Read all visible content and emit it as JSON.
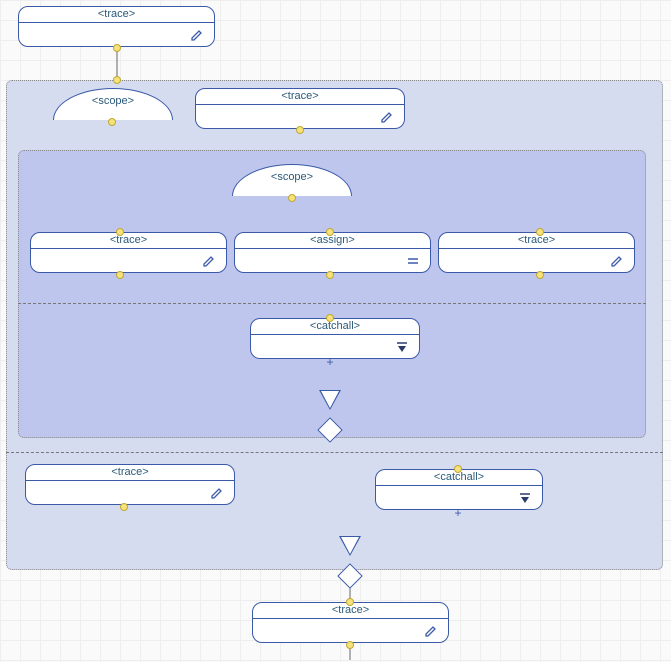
{
  "nodes": {
    "topTrace": {
      "label": "<trace>"
    },
    "outerScope": {
      "label": "<scope>"
    },
    "outerScopeTrace": {
      "label": "<trace>"
    },
    "innerScope": {
      "label": "<scope>"
    },
    "innerTraceL": {
      "label": "<trace>"
    },
    "assign": {
      "label": "<assign>"
    },
    "innerTraceR": {
      "label": "<trace>"
    },
    "lowerCatchall": {
      "label": "<catchall>"
    },
    "lowerTrace": {
      "label": "<trace>"
    },
    "innerCatchall": {
      "label": "<catchall>"
    },
    "bottomTrace": {
      "label": "<trace>"
    }
  },
  "icons": {
    "pen": "pen-icon",
    "equals": "equals-icon",
    "collapse": "collapse-icon",
    "plus": "plus-icon"
  }
}
